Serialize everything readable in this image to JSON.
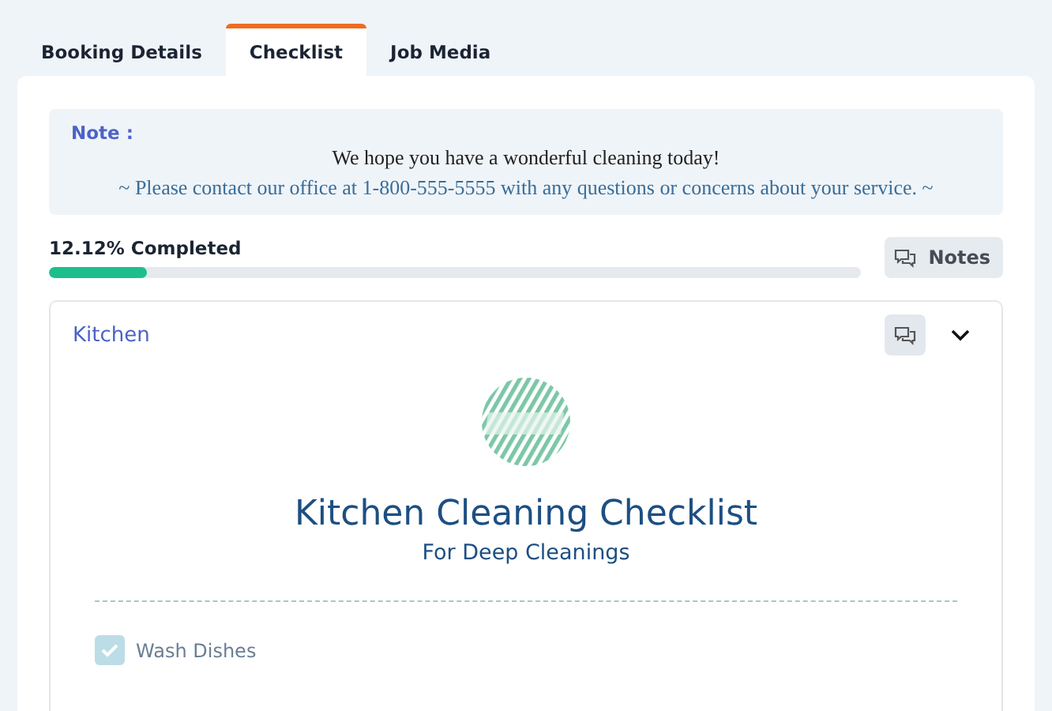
{
  "tabs": [
    {
      "label": "Booking Details",
      "selected": false
    },
    {
      "label": "Checklist",
      "selected": true
    },
    {
      "label": "Job Media",
      "selected": false
    }
  ],
  "note": {
    "label": "Note :",
    "lines": [
      "We hope you have a wonderful cleaning today!",
      "~ Please contact our office at 1-800-555-5555 with any questions or concerns about your service. ~"
    ]
  },
  "progress": {
    "label": "12.12% Completed",
    "level": 0.1212,
    "notes_button": "Notes"
  },
  "section": {
    "title": "Kitchen",
    "expanded": true,
    "heading": "Kitchen Cleaning Checklist",
    "subheading": "For Deep Cleanings",
    "items": [
      {
        "label": "Wash Dishes",
        "checked": true
      }
    ]
  }
}
